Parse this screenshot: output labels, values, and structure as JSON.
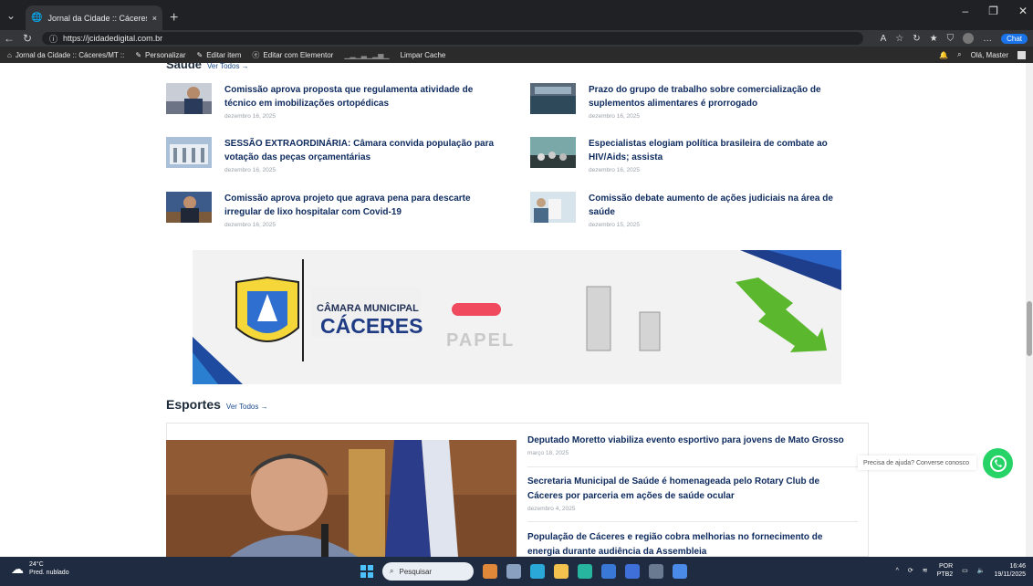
{
  "browser": {
    "tab_title": "Jornal da Cidade :: Cáceres/MT :: -",
    "tab_close": "×",
    "new_tab": "+",
    "url": "https://jcidadedigital.com.br",
    "chat_label": "Chat"
  },
  "bookmarks": {
    "items": [
      {
        "label": "Jornal da Cidade :: Cáceres/MT ::"
      },
      {
        "label": "Personalizar"
      },
      {
        "label": "Editar item"
      },
      {
        "label": "Editar com Elementor"
      },
      {
        "label": "Limpar Cache"
      }
    ],
    "greeting": "Olá, Master"
  },
  "saude": {
    "title": "Saúde",
    "see_all": "Ver Todos →",
    "left": [
      {
        "title": "Comissão aprova proposta que regulamenta atividade de técnico em imobilizações ortopédicas",
        "date": "dezembro 16, 2025"
      },
      {
        "title": "SESSÃO EXTRAORDINÁRIA: Câmara convida população para votação das peças orçamentárias",
        "date": "dezembro 16, 2025"
      },
      {
        "title": "Comissão aprova projeto que agrava pena para descarte irregular de lixo hospitalar com Covid-19",
        "date": "dezembro 16, 2025"
      }
    ],
    "right": [
      {
        "title": "Prazo do grupo de trabalho sobre comercialização de suplementos alimentares é prorrogado",
        "date": "dezembro 16, 2025"
      },
      {
        "title": "Especialistas elogiam política brasileira de combate ao HIV/Aids; assista",
        "date": "dezembro 16, 2025"
      },
      {
        "title": "Comissão debate aumento de ações judiciais na área de saúde",
        "date": "dezembro 15, 2025"
      }
    ]
  },
  "banner": {
    "line1": "CÂMARA MUNICIPAL",
    "line2": "CÁCERES",
    "papel": "PAPEL"
  },
  "esportes": {
    "title": "Esportes",
    "see_all": "Ver Todos →",
    "items": [
      {
        "title": "Deputado Moretto viabiliza evento esportivo para jovens de Mato Grosso",
        "date": "março 18, 2025"
      },
      {
        "title": "Secretaria Municipal de Saúde é homenageada pelo Rotary Club de Cáceres por parceria em ações de saúde ocular",
        "date": "dezembro 4, 2025"
      },
      {
        "title": "População de Cáceres e região cobra melhorias no fornecimento de energia durante audiência da Assembleia",
        "date": ""
      }
    ]
  },
  "chat": {
    "text": "Precisa de ajuda? Converse conosco"
  },
  "taskbar": {
    "temp": "24°C",
    "weather": "Pred. nublado",
    "search": "Pesquisar",
    "lang1": "POR",
    "lang2": "PTB2",
    "time": "16:46",
    "date": "19/11/2025"
  },
  "colors": {
    "accent": "#1a73e8",
    "headline": "#0d2a5e",
    "whatsapp": "#25d366"
  }
}
